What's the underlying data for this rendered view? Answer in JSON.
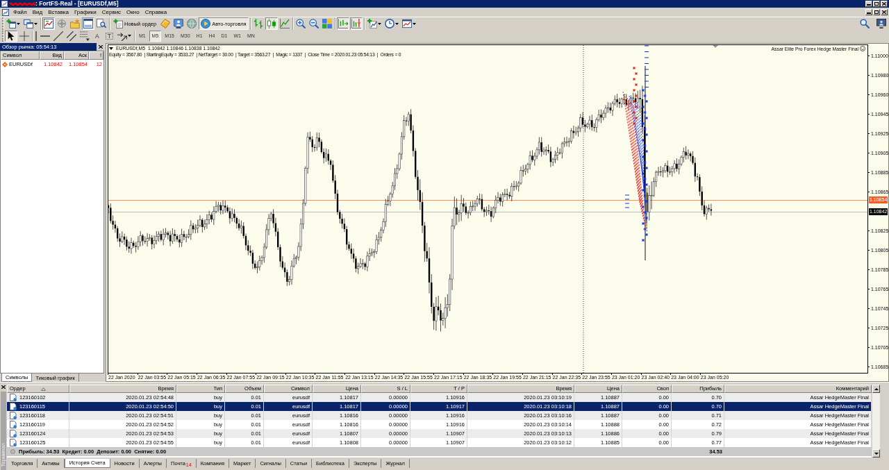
{
  "window": {
    "title": ": FortFS-Real - [EURUSDf,M5]"
  },
  "menu": [
    "Файл",
    "Вид",
    "Вставка",
    "Графики",
    "Сервис",
    "Окно",
    "Справка"
  ],
  "toolbar": [
    [
      {
        "kind": "icon",
        "pressed": false
      },
      {
        "kind": "icon",
        "pressed": false
      }
    ],
    [
      {
        "kind": "icon",
        "pressed": true
      },
      {
        "kind": "icon",
        "pressed": false
      },
      {
        "kind": "icon",
        "pressed": false
      },
      {
        "kind": "icon",
        "pressed": true
      },
      {
        "kind": "icon",
        "pressed": false
      }
    ],
    [
      {
        "kind": "text",
        "label": "Новый ордер",
        "pressed": false
      },
      {
        "kind": "icon",
        "pressed": false
      },
      {
        "kind": "icon",
        "pressed": false
      },
      {
        "kind": "icon",
        "pressed": false
      },
      {
        "kind": "text",
        "label": "Авто-торговля",
        "pressed": true
      }
    ],
    [
      {
        "kind": "icon",
        "pressed": false
      },
      {
        "kind": "icon",
        "pressed": true
      },
      {
        "kind": "icon",
        "pressed": false
      }
    ],
    [
      {
        "kind": "icon",
        "pressed": false
      },
      {
        "kind": "icon",
        "pressed": false
      },
      {
        "kind": "icon",
        "pressed": false
      }
    ],
    [
      {
        "kind": "icon",
        "pressed": true
      },
      {
        "kind": "icon",
        "pressed": true
      }
    ],
    [
      {
        "kind": "icon",
        "pressed": false
      },
      {
        "kind": "icon",
        "pressed": false
      },
      {
        "kind": "icon",
        "pressed": false
      }
    ]
  ],
  "drawing_tools": [
    [
      {
        "kind": "icon",
        "pressed": true
      },
      {
        "kind": "icon",
        "pressed": false
      }
    ],
    [
      {
        "kind": "icon",
        "pressed": false
      },
      {
        "kind": "icon",
        "pressed": false
      },
      {
        "kind": "icon",
        "pressed": false
      },
      {
        "kind": "icon",
        "pressed": false
      },
      {
        "kind": "icon",
        "pressed": false
      },
      {
        "kind": "glyph",
        "glyph": "A",
        "pressed": false
      },
      {
        "kind": "framed-glyph",
        "glyph": "T",
        "pressed": false
      },
      {
        "kind": "icon",
        "pressed": false
      }
    ]
  ],
  "timeframes": [
    {
      "label": "M1",
      "selected": false
    },
    {
      "label": "M5",
      "selected": true
    },
    {
      "label": "M15",
      "selected": false
    },
    {
      "label": "M30",
      "selected": false
    },
    {
      "label": "H1",
      "selected": false
    },
    {
      "label": "H4",
      "selected": false
    },
    {
      "label": "D1",
      "selected": false
    },
    {
      "label": "W1",
      "selected": false
    },
    {
      "label": "MN",
      "selected": false
    }
  ],
  "market_watch": {
    "title": "Обзор рынка: 05:54:13",
    "columns": [
      "Символ",
      "Вид",
      "Аск",
      "!"
    ],
    "rows": [
      {
        "symbol": "EURUSDf",
        "bid": "1.10842",
        "ask": "1.10854",
        "spread": "12",
        "falling": true
      }
    ],
    "tabs": [
      {
        "label": "Символы",
        "selected": true
      },
      {
        "label": "Тиковый график",
        "selected": false
      }
    ]
  },
  "chart": {
    "symbol": "EURUSDf,M5",
    "ohlc": "1.10842 1.10846 1.10838 1.10842",
    "info": "Equity = 3567.80  | StartingEquity = 3533.27  | NetTarget = 30.00  | Target = 3563.27  |  Magic = 1337  |  Close Time = 2020.01.23 05:54:13  |  Orders = 0",
    "expert": "Assar Elite Pro Forex Hedge Master Final",
    "expert_running": true,
    "price_labels": [
      "1.11000",
      "1.10980",
      "1.10960",
      "1.10945",
      "1.10925",
      "1.10905",
      "1.10885",
      "1.10865",
      "1.10825",
      "1.10805",
      "1.10785",
      "1.10765",
      "1.10745",
      "1.10725",
      "1.10705",
      "1.10685"
    ],
    "ask_price": "1.10854",
    "bid_price": "1.10842",
    "time_labels": [
      "22 Jan 2020",
      "22 Jan 03:55",
      "22 Jan 05:15",
      "22 Jan 06:35",
      "22 Jan 07:55",
      "22 Jan 09:15",
      "22 Jan 10:35",
      "22 Jan 11:55",
      "22 Jan 13:15",
      "22 Jan 14:35",
      "22 Jan 15:55",
      "22 Jan 17:15",
      "22 Jan 18:35",
      "22 Jan 19:55",
      "22 Jan 21:15",
      "22 Jan 22:35",
      "22 Jan 23:55",
      "23 Jan 01:20",
      "23 Jan 02:40",
      "23 Jan 04:00",
      "23 Jan 05:20"
    ]
  },
  "terminal": {
    "title": "Терминал",
    "columns": [
      {
        "label": "Ордер",
        "sorted": true
      },
      {
        "label": "Время",
        "sorted": false
      },
      {
        "label": "Тип",
        "sorted": false
      },
      {
        "label": "Объем",
        "sorted": false
      },
      {
        "label": "Символ",
        "sorted": false
      },
      {
        "label": "Цена",
        "sorted": false
      },
      {
        "label": "S / L",
        "sorted": false
      },
      {
        "label": "T / P",
        "sorted": false
      },
      {
        "label": "Время",
        "sorted": false
      },
      {
        "label": "Цена",
        "sorted": false
      },
      {
        "label": "Своп",
        "sorted": false
      },
      {
        "label": "Прибыль",
        "sorted": false
      },
      {
        "label": "Комментарий",
        "sorted": false
      }
    ],
    "rows": [
      {
        "cells": [
          "123160102",
          "2020.01.23 02:54:48",
          "buy",
          "0.01",
          "eurusdf",
          "1.10817",
          "0.00000",
          "1.10916",
          "2020.01.23 03:10:19",
          "1.10887",
          "0.00",
          "0.70",
          "Assar HedgeMaster Final"
        ],
        "selected": false
      },
      {
        "cells": [
          "123160115",
          "2020.01.23 02:54:50",
          "buy",
          "0.01",
          "eurusdf",
          "1.10817",
          "0.00000",
          "1.10917",
          "2020.01.23 03:10:18",
          "1.10887",
          "0.00",
          "0.70",
          "Assar HedgeMaster Final"
        ],
        "selected": true
      },
      {
        "cells": [
          "123160118",
          "2020.01.23 02:54:51",
          "buy",
          "0.01",
          "eurusdf",
          "1.10816",
          "0.00000",
          "1.10916",
          "2020.01.23 03:10:16",
          "1.10887",
          "0.00",
          "0.71",
          "Assar HedgeMaster Final"
        ],
        "selected": false
      },
      {
        "cells": [
          "123160119",
          "2020.01.23 02:54:52",
          "buy",
          "0.01",
          "eurusdf",
          "1.10816",
          "0.00000",
          "1.10916",
          "2020.01.23 03:10:14",
          "1.10888",
          "0.00",
          "0.72",
          "Assar HedgeMaster Final"
        ],
        "selected": false
      },
      {
        "cells": [
          "123160124",
          "2020.01.23 02:54:53",
          "buy",
          "0.01",
          "eurusdf",
          "1.10807",
          "0.00000",
          "1.10907",
          "2020.01.23 03:10:13",
          "1.10886",
          "0.00",
          "0.79",
          "Assar HedgeMaster Final"
        ],
        "selected": false
      },
      {
        "cells": [
          "123160125",
          "2020.01.23 02:54:55",
          "buy",
          "0.01",
          "eurusdf",
          "1.10808",
          "0.00000",
          "1.10907",
          "2020.01.23 03:10:12",
          "1.10885",
          "0.00",
          "0.77",
          "Assar HedgeMaster Final"
        ],
        "selected": false
      }
    ],
    "summary": "Прибыль: 34.53  Кредит: 0.00  Депозит: 0.00  Снятие: 0.00",
    "total_profit": "34.53",
    "tabs": [
      {
        "label": "Торговля",
        "selected": false
      },
      {
        "label": "Активы",
        "selected": false
      },
      {
        "label": "История Счета",
        "selected": true
      },
      {
        "label": "Новости",
        "selected": false
      },
      {
        "label": "Алерты",
        "selected": false
      },
      {
        "label": "Почта",
        "selected": false,
        "badge": "14"
      },
      {
        "label": "Компания",
        "selected": false
      },
      {
        "label": "Маркет",
        "selected": false
      },
      {
        "label": "Сигналы",
        "selected": false
      },
      {
        "label": "Статьи",
        "selected": false
      },
      {
        "label": "Библиотека",
        "selected": false
      },
      {
        "label": "Эксперты",
        "selected": false
      },
      {
        "label": "Журнал",
        "selected": false
      }
    ]
  }
}
